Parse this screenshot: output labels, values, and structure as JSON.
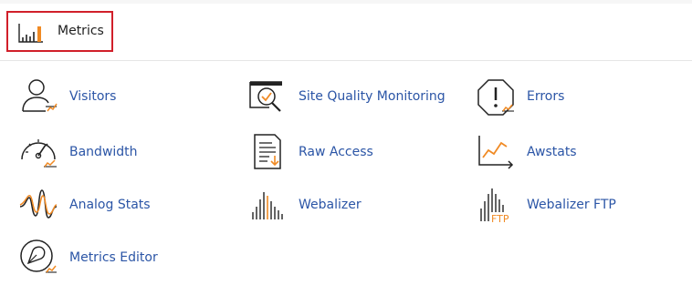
{
  "section": {
    "title": "Metrics",
    "icon": "bar-chart-icon"
  },
  "colors": {
    "accent": "#f08a24",
    "link": "#2b55a6",
    "highlight_border": "#d11f2a"
  },
  "items": [
    {
      "label": "Visitors",
      "icon": "visitors-icon"
    },
    {
      "label": "Site Quality Monitoring",
      "icon": "site-quality-icon"
    },
    {
      "label": "Errors",
      "icon": "errors-icon"
    },
    {
      "label": "Bandwidth",
      "icon": "bandwidth-icon"
    },
    {
      "label": "Raw Access",
      "icon": "raw-access-icon"
    },
    {
      "label": "Awstats",
      "icon": "awstats-icon"
    },
    {
      "label": "Analog Stats",
      "icon": "analog-stats-icon"
    },
    {
      "label": "Webalizer",
      "icon": "webalizer-icon"
    },
    {
      "label": "Webalizer FTP",
      "icon": "webalizer-ftp-icon",
      "icon_text": "FTP"
    },
    {
      "label": "Metrics Editor",
      "icon": "metrics-editor-icon"
    }
  ]
}
